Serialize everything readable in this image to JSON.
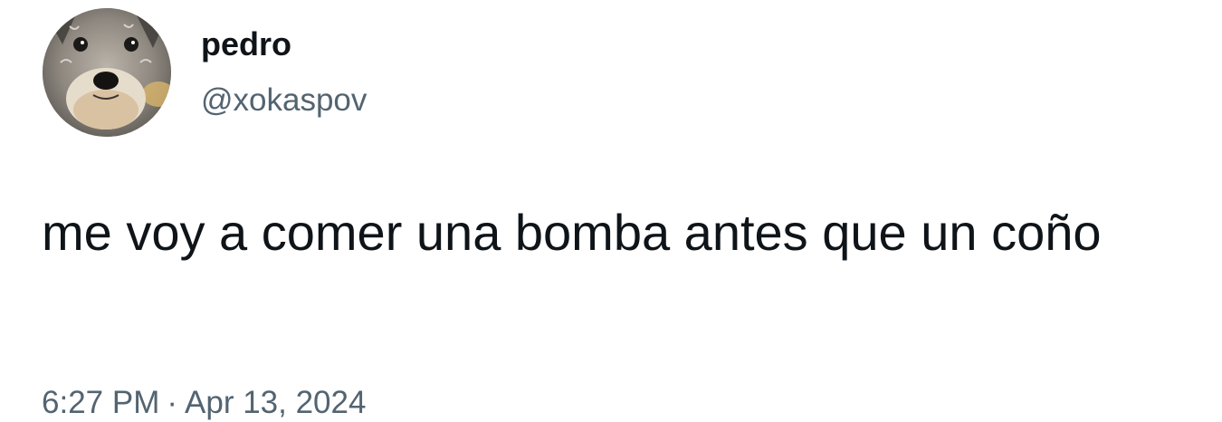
{
  "tweet": {
    "author": {
      "display_name": "pedro",
      "handle": "@xokaspov",
      "avatar_icon": "dog-avatar"
    },
    "text": "me voy a comer una bomba antes que un coño",
    "time": "6:27 PM",
    "separator": "·",
    "date": "Apr 13, 2024"
  },
  "colors": {
    "primary_text": "#0f1419",
    "secondary_text": "#536471",
    "background": "#ffffff"
  }
}
